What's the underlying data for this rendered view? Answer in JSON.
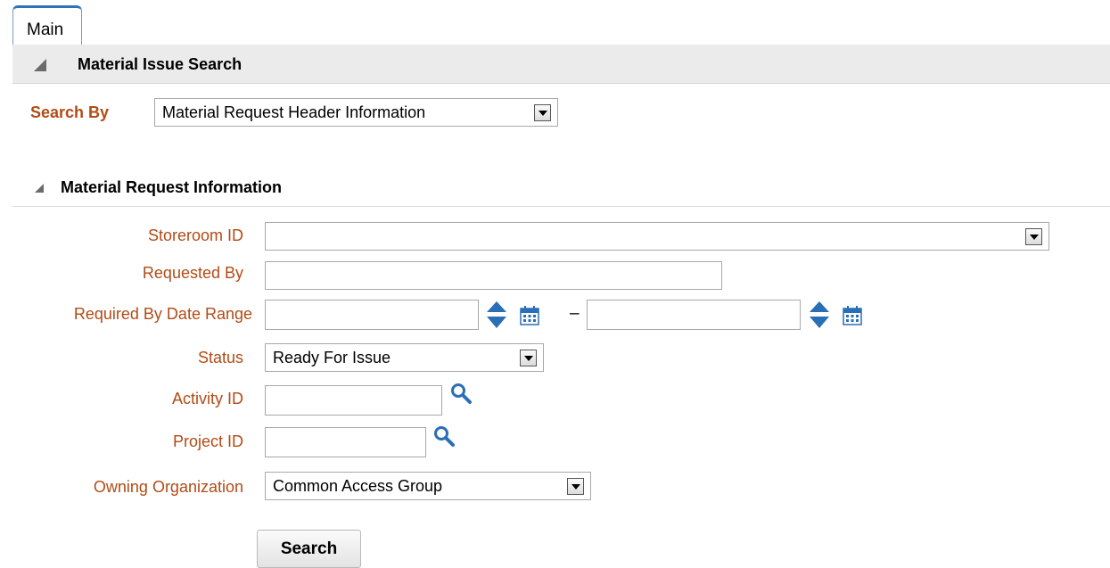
{
  "tabs": [
    {
      "label": "Main"
    }
  ],
  "section_title": "Material Issue Search",
  "search_by": {
    "label": "Search By",
    "selected": "Material Request Header Information"
  },
  "subsection_title": "Material Request Information",
  "fields": {
    "storeroom_id": {
      "label": "Storeroom ID",
      "value": ""
    },
    "requested_by": {
      "label": "Requested By",
      "value": ""
    },
    "required_by_date_range": {
      "label": "Required By Date Range",
      "from": "",
      "to": "",
      "separator": "–"
    },
    "status": {
      "label": "Status",
      "selected": "Ready For Issue"
    },
    "activity_id": {
      "label": "Activity ID",
      "value": ""
    },
    "project_id": {
      "label": "Project ID",
      "value": ""
    },
    "owning_organization": {
      "label": "Owning Organization",
      "selected": "Common Access Group"
    }
  },
  "buttons": {
    "search": "Search"
  },
  "icons": {
    "section_toggle": "collapse-triangle-icon",
    "spinner": "spinner-arrows-icon",
    "calendar": "calendar-icon",
    "lookup": "magnifier-icon",
    "dropdown": "chevron-down-icon"
  },
  "colors": {
    "label": "#b24b16",
    "accent": "#2d73b8",
    "header_bg": "#ebebeb",
    "icon_blue": "#2a6fb5"
  }
}
